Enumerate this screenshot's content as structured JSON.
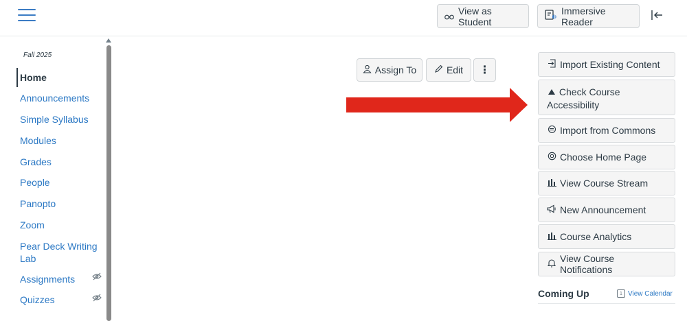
{
  "topbar": {
    "view_as_student": "View as Student",
    "immersive_reader": "Immersive Reader"
  },
  "sidebar": {
    "term": "Fall 2025",
    "items": [
      {
        "label": "Home",
        "active": true
      },
      {
        "label": "Announcements"
      },
      {
        "label": "Simple Syllabus"
      },
      {
        "label": "Modules"
      },
      {
        "label": "Grades"
      },
      {
        "label": "People"
      },
      {
        "label": "Panopto"
      },
      {
        "label": "Zoom"
      },
      {
        "label": "Pear Deck Writing Lab"
      },
      {
        "label": "Assignments",
        "hidden": true
      },
      {
        "label": "Quizzes",
        "hidden": true
      }
    ]
  },
  "content_toolbar": {
    "assign_to": "Assign To",
    "edit": "Edit",
    "more": "⋮"
  },
  "right_panel": {
    "buttons": [
      {
        "label": "Import Existing Content",
        "icon": "import-icon"
      },
      {
        "label": "Check Course Accessibility",
        "icon": "accessibility-icon"
      },
      {
        "label": "Import from Commons",
        "icon": "commons-icon"
      },
      {
        "label": "Choose Home Page",
        "icon": "target-icon"
      },
      {
        "label": "View Course Stream",
        "icon": "bar-chart-icon"
      },
      {
        "label": "New Announcement",
        "icon": "megaphone-icon"
      },
      {
        "label": "Course Analytics",
        "icon": "bar-chart-icon"
      },
      {
        "label": "View Course Notifications",
        "icon": "bell-icon"
      }
    ],
    "coming_up": "Coming Up",
    "view_calendar": "View Calendar"
  },
  "colors": {
    "link": "#2b78c4",
    "text": "#2d3b45",
    "annotation_arrow": "#e0271b"
  }
}
